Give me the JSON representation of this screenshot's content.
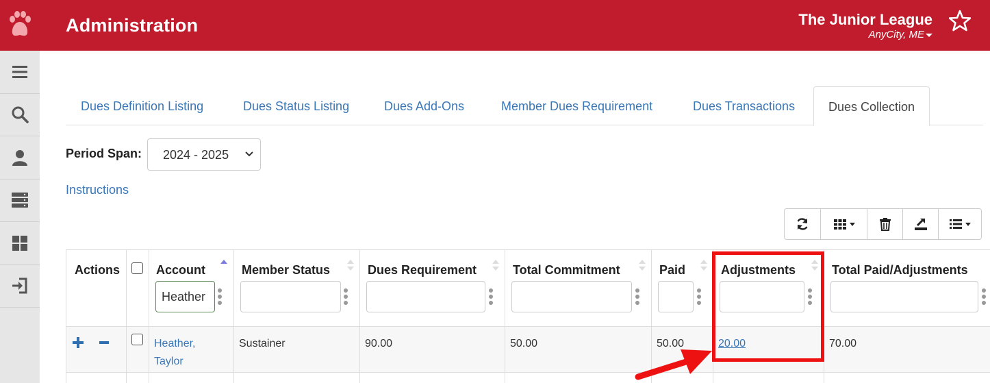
{
  "header": {
    "app_title": "Administration",
    "org_name": "The Junior League",
    "org_city": "AnyCity, ME",
    "brand_color": "#c11c2d"
  },
  "sidebar": {
    "items": [
      {
        "icon": "menu-icon"
      },
      {
        "icon": "search-icon"
      },
      {
        "icon": "user-icon"
      },
      {
        "icon": "server-icon"
      },
      {
        "icon": "dashboard-icon"
      },
      {
        "icon": "sign-out-icon"
      }
    ]
  },
  "tabs": [
    {
      "label": "Dues Definition Listing"
    },
    {
      "label": "Dues Status Listing"
    },
    {
      "label": "Dues Add-Ons"
    },
    {
      "label": "Member Dues Requirement"
    },
    {
      "label": "Dues Transactions"
    },
    {
      "label": "Dues Collection",
      "active": true
    }
  ],
  "period": {
    "label": "Period Span:",
    "value": "2024 - 2025"
  },
  "instructions_label": "Instructions",
  "toolbar": {
    "buttons": [
      "refresh-icon",
      "columns-icon",
      "trash-icon",
      "export-icon",
      "list-icon"
    ]
  },
  "table": {
    "columns": [
      {
        "label": "Actions"
      },
      {
        "label": ""
      },
      {
        "label": "Account",
        "filter": "Heather",
        "sorted": "asc"
      },
      {
        "label": "Member Status",
        "filter": ""
      },
      {
        "label": "Dues Requirement",
        "filter": ""
      },
      {
        "label": "Total Commitment",
        "filter": ""
      },
      {
        "label": "Paid",
        "filter": ""
      },
      {
        "label": "Adjustments",
        "filter": ""
      },
      {
        "label": "Total Paid/Adjustments",
        "filter": ""
      }
    ],
    "rows": [
      {
        "account_line1": "Heather,",
        "account_line2": "Taylor",
        "member_status": "Sustainer",
        "dues_requirement": "90.00",
        "total_commitment": "50.00",
        "paid": "50.00",
        "adjustments": "20.00",
        "total_paid_adjustments": "70.00"
      }
    ]
  },
  "annotation_color": "#ee1111"
}
